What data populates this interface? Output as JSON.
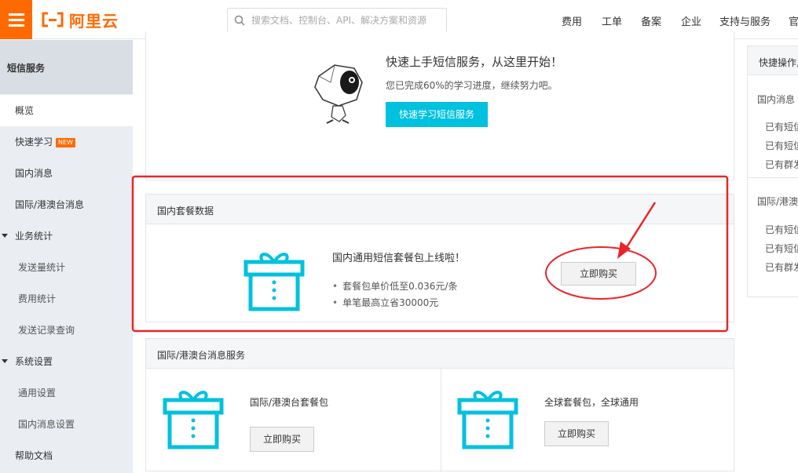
{
  "header": {
    "logo_text": "阿里云",
    "search_placeholder": "搜索文档、控制台、API、解决方案和资源",
    "nav": [
      "费用",
      "工单",
      "备案",
      "企业",
      "支持与服务",
      "官"
    ]
  },
  "sidebar": {
    "title": "短信服务",
    "items": [
      {
        "label": "概览"
      },
      {
        "label": "快速学习",
        "badge": "NEW"
      },
      {
        "label": "国内消息"
      },
      {
        "label": "国际/港澳台消息"
      },
      {
        "label": "业务统计"
      },
      {
        "label": "发送量统计"
      },
      {
        "label": "费用统计"
      },
      {
        "label": "发送记录查询"
      },
      {
        "label": "系统设置"
      },
      {
        "label": "通用设置"
      },
      {
        "label": "国内消息设置"
      },
      {
        "label": "帮助文档"
      }
    ]
  },
  "welcome": {
    "title": "快速上手短信服务，从这里开始！",
    "subtitle": "您已完成60%的学习进度，继续努力吧。",
    "progress": 0.6,
    "button": "快速学习短信服务"
  },
  "domestic_package": {
    "header": "国内套餐数据",
    "title": "国内通用短信套餐包上线啦！",
    "bullets": [
      "套餐包单价低至0.036元/条",
      "单笔最高立省30000元"
    ],
    "button": "立即购买"
  },
  "intl_package": {
    "header": "国际/港澳台消息服务",
    "left": {
      "text": "国际/港澳台套餐包",
      "button": "立即购买"
    },
    "right": {
      "text": "全球套餐包，全球通用",
      "button": "立即购买"
    }
  },
  "right_panel": {
    "title": "快捷操作,",
    "section1": "国内消息",
    "section1_items": [
      "已有短信",
      "已有短信",
      "已有群发"
    ],
    "section2": "国际/港澳",
    "section2_items": [
      "已有短信",
      "已有短信",
      "已有群发"
    ]
  },
  "colors": {
    "brand_orange": "#ff6a00",
    "accent_cyan": "#00c1de",
    "annotation_red": "#e8262a"
  }
}
